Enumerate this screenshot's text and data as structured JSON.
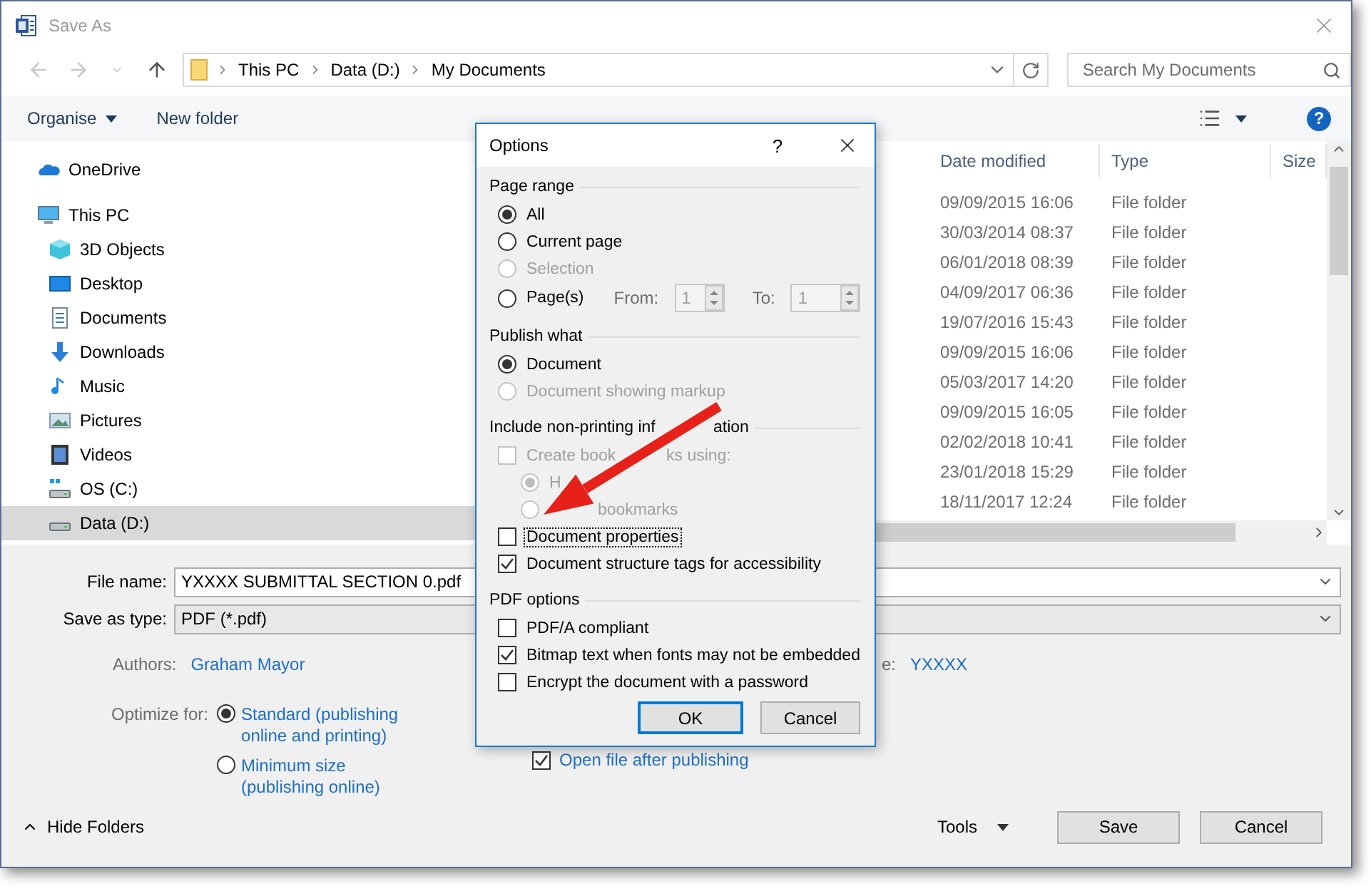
{
  "window": {
    "title": "Save As"
  },
  "address": {
    "path": [
      "This PC",
      "Data (D:)",
      "My Documents"
    ]
  },
  "search": {
    "placeholder": "Search My Documents"
  },
  "toolbar": {
    "organise": "Organise",
    "new_folder": "New folder",
    "help": "?"
  },
  "navigation": {
    "items": [
      {
        "label": "OneDrive",
        "kind": "cloud",
        "selected": false
      },
      {
        "label": "This PC",
        "kind": "computer",
        "selected": false,
        "children": [
          {
            "label": "3D Objects",
            "kind": "cube",
            "selected": false
          },
          {
            "label": "Desktop",
            "kind": "desktop",
            "selected": false
          },
          {
            "label": "Documents",
            "kind": "document",
            "selected": false
          },
          {
            "label": "Downloads",
            "kind": "download",
            "selected": false
          },
          {
            "label": "Music",
            "kind": "music",
            "selected": false
          },
          {
            "label": "Pictures",
            "kind": "pictures",
            "selected": false
          },
          {
            "label": "Videos",
            "kind": "videos",
            "selected": false
          },
          {
            "label": "OS (C:)",
            "kind": "system-drive",
            "selected": false
          },
          {
            "label": "Data (D:)",
            "kind": "drive",
            "selected": true
          }
        ]
      }
    ]
  },
  "file_list": {
    "columns": [
      "Date modified",
      "Type",
      "Size"
    ],
    "rows": [
      {
        "date_modified": "09/09/2015 16:06",
        "type": "File folder"
      },
      {
        "date_modified": "30/03/2014 08:37",
        "type": "File folder"
      },
      {
        "date_modified": "06/01/2018 08:39",
        "type": "File folder"
      },
      {
        "date_modified": "04/09/2017 06:36",
        "type": "File folder"
      },
      {
        "date_modified": "19/07/2016 15:43",
        "type": "File folder"
      },
      {
        "date_modified": "09/09/2015 16:06",
        "type": "File folder"
      },
      {
        "date_modified": "05/03/2017 14:20",
        "type": "File folder"
      },
      {
        "date_modified": "09/09/2015 16:05",
        "type": "File folder"
      },
      {
        "date_modified": "02/02/2018 10:41",
        "type": "File folder"
      },
      {
        "date_modified": "23/01/2018 15:29",
        "type": "File folder"
      },
      {
        "date_modified": "18/11/2017 12:24",
        "type": "File folder"
      }
    ]
  },
  "form": {
    "file_name": {
      "label": "File name:",
      "value": "YXXXX SUBMITTAL SECTION 0.pdf"
    },
    "save_as_type": {
      "label": "Save as type:",
      "value": "PDF (*.pdf)"
    },
    "authors": {
      "label": "Authors:",
      "value": "Graham Mayor"
    },
    "title": {
      "label": "e:",
      "value": "YXXXX"
    },
    "optimize": {
      "label": "Optimize for:",
      "options": [
        {
          "label": "Standard (publishing online and printing)",
          "selected": true
        },
        {
          "label": "Minimum size (publishing online)",
          "selected": false
        }
      ]
    },
    "open_after": {
      "label": "Open file after publishing",
      "checked": true
    }
  },
  "footer": {
    "hide_folders": "Hide Folders",
    "tools": "Tools",
    "save": "Save",
    "cancel": "Cancel"
  },
  "options_dialog": {
    "title": "Options",
    "help": "?",
    "page_range": {
      "heading": "Page range",
      "options": [
        {
          "label": "All",
          "selected": true,
          "disabled": false
        },
        {
          "label": "Current page",
          "selected": false,
          "disabled": false
        },
        {
          "label": "Selection",
          "selected": false,
          "disabled": true
        },
        {
          "label": "Page(s)",
          "selected": false,
          "disabled": false
        }
      ],
      "from": {
        "label": "From:",
        "value": "1"
      },
      "to": {
        "label": "To:",
        "value": "1"
      }
    },
    "publish_what": {
      "heading": "Publish what",
      "options": [
        {
          "label": "Document",
          "selected": true,
          "disabled": false
        },
        {
          "label": "Document showing markup",
          "selected": false,
          "disabled": true
        }
      ]
    },
    "non_printing": {
      "heading": [
        "Include non-printing inf",
        "ation"
      ],
      "bookmarks": {
        "label": [
          "Create book",
          "ks using:"
        ],
        "checked": false,
        "disabled": true,
        "options": [
          {
            "label": [
              "H"
            ],
            "selected": true,
            "disabled": true
          },
          {
            "label": [
              "bookmarks"
            ],
            "selected": false,
            "disabled": true
          }
        ]
      },
      "checks": [
        {
          "label": "Document properties",
          "checked": false,
          "focused": true
        },
        {
          "label": "Document structure tags for accessibility",
          "checked": true,
          "focused": false
        }
      ]
    },
    "pdf_options": {
      "heading": "PDF options",
      "checks": [
        {
          "label": "PDF/A compliant",
          "checked": false,
          "focused": false
        },
        {
          "label": "Bitmap text when fonts may not be embedded",
          "checked": true,
          "focused": false
        },
        {
          "label": "Encrypt the document with a password",
          "checked": false,
          "focused": false
        }
      ]
    },
    "buttons": [
      {
        "label": "OK",
        "default": true
      },
      {
        "label": "Cancel",
        "default": false
      }
    ]
  }
}
